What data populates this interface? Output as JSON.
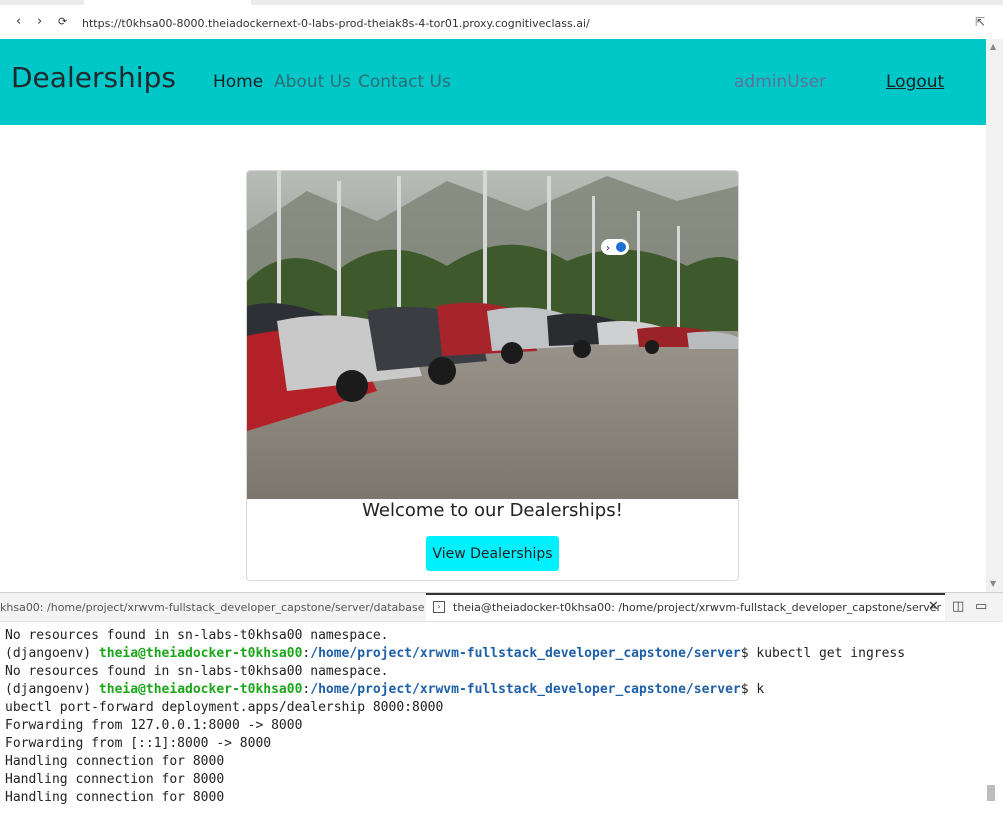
{
  "browser": {
    "url": "https://t0khsa00-8000.theiadockernext-0-labs-prod-theiak8s-4-tor01.proxy.cognitiveclass.ai/",
    "back_glyph": "‹",
    "forward_glyph": "›",
    "reload_glyph": "⟳",
    "external_glyph": "⇱"
  },
  "site": {
    "brand": "Dealerships",
    "nav": [
      {
        "label": "Home"
      },
      {
        "label": "About Us"
      },
      {
        "label": "Contact Us"
      }
    ],
    "user": "adminUser",
    "logout": "Logout",
    "welcome": "Welcome to our Dealerships!",
    "cta": "View Dealerships",
    "colors": {
      "header": "#00c8c8",
      "button": "#00f0ff"
    }
  },
  "terminal": {
    "tab1_title": "khsa00: /home/project/xrwvm-fullstack_developer_capstone/server/database",
    "tab2_title": "theia@theiadocker-t0khsa00: /home/project/xrwvm-fullstack_developer_capstone/server",
    "lines": [
      {
        "text": "No resources found in sn-labs-t0khsa00 namespace."
      },
      {
        "prefix": "(djangoenv) ",
        "user": "theia@theiadocker-t0khsa00",
        "sep": ":",
        "path": "/home/project/xrwvm-fullstack_developer_capstone/server",
        "cmd": "$ kubectl get ingress"
      },
      {
        "text": "No resources found in sn-labs-t0khsa00 namespace."
      },
      {
        "prefix": "(djangoenv) ",
        "user": "theia@theiadocker-t0khsa00",
        "sep": ":",
        "path": "/home/project/xrwvm-fullstack_developer_capstone/server",
        "cmd": "$ k"
      },
      {
        "text": "ubectl port-forward deployment.apps/dealership 8000:8000"
      },
      {
        "text": "Forwarding from 127.0.0.1:8000 -> 8000"
      },
      {
        "text": "Forwarding from [::1]:8000 -> 8000"
      },
      {
        "text": "Handling connection for 8000"
      },
      {
        "text": "Handling connection for 8000"
      },
      {
        "text": "Handling connection for 8000"
      }
    ]
  }
}
